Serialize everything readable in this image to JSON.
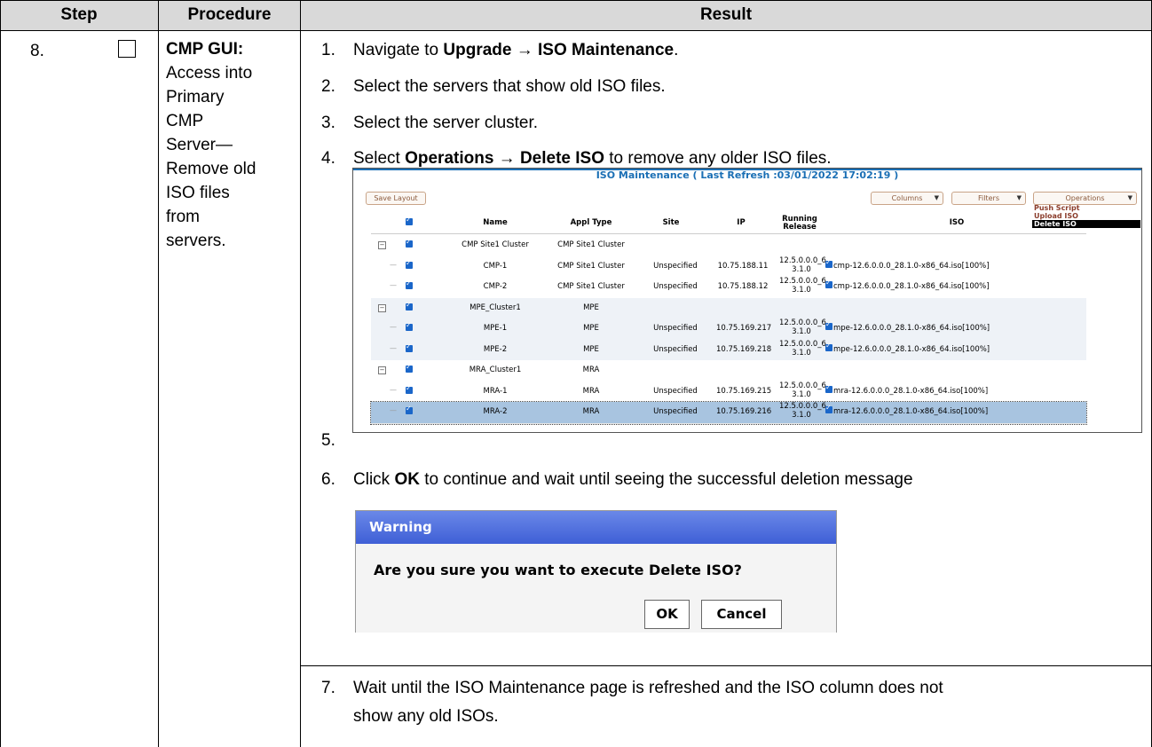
{
  "headers": {
    "step": "Step",
    "procedure": "Procedure",
    "result": "Result"
  },
  "step_number": "8.",
  "procedure": {
    "heading": "CMP GUI:",
    "lines": [
      "Access into",
      "Primary",
      "CMP",
      "Server—",
      "Remove old",
      "ISO files",
      "from",
      "servers."
    ]
  },
  "steps": {
    "s1": {
      "num": "1.",
      "pre": "Navigate to ",
      "bold": "Upgrade → ISO Maintenance",
      "post": "."
    },
    "s2": {
      "num": "2.",
      "text": "Select the servers that show old ISO files."
    },
    "s3": {
      "num": "3.",
      "text": "Select the server cluster."
    },
    "s4": {
      "num": "4.",
      "pre": "Select ",
      "bold": "Operations → Delete ISO",
      "post": " to remove any older ISO files."
    },
    "s5": {
      "num": "5."
    },
    "s6": {
      "num": "6.",
      "pre": "Click ",
      "bold": "OK",
      "post": " to continue and wait until seeing the successful deletion message"
    },
    "s7": {
      "num": "7.",
      "line1": "Wait until the ISO Maintenance page is refreshed and the ISO column does not",
      "line2": "show any old ISOs."
    }
  },
  "iso_screen": {
    "title": "ISO Maintenance ( Last Refresh :03/01/2022 17:02:19 )",
    "save_layout": "Save Layout",
    "columns_btn": "Columns",
    "filters_btn": "Filters",
    "operations_btn": "Operations",
    "operations_menu": [
      "Push Script",
      "Upload ISO",
      "Delete ISO"
    ],
    "columns": {
      "name": "Name",
      "appl_type": "Appl Type",
      "site": "Site",
      "ip": "IP",
      "running_release_1": "Running",
      "running_release_2": "Release",
      "iso": "ISO"
    },
    "rows": [
      {
        "kind": "cluster",
        "name": "CMP Site1 Cluster",
        "appl": "CMP Site1 Cluster",
        "site": "",
        "ip": "",
        "rel1": "",
        "rel2": "",
        "iso": ""
      },
      {
        "kind": "server",
        "name": "CMP-1",
        "appl": "CMP Site1 Cluster",
        "site": "Unspecified",
        "ip": "10.75.188.11",
        "rel1": "12.5.0.0.0_6",
        "rel2": "3.1.0",
        "iso": "cmp-12.6.0.0.0_28.1.0-x86_64.iso[100%]"
      },
      {
        "kind": "server",
        "name": "CMP-2",
        "appl": "CMP Site1 Cluster",
        "site": "Unspecified",
        "ip": "10.75.188.12",
        "rel1": "12.5.0.0.0_6",
        "rel2": "3.1.0",
        "iso": "cmp-12.6.0.0.0_28.1.0-x86_64.iso[100%]"
      },
      {
        "kind": "cluster",
        "name": "MPE_Cluster1",
        "appl": "MPE",
        "site": "",
        "ip": "",
        "rel1": "",
        "rel2": "",
        "iso": ""
      },
      {
        "kind": "server",
        "name": "MPE-1",
        "appl": "MPE",
        "site": "Unspecified",
        "ip": "10.75.169.217",
        "rel1": "12.5.0.0.0_6",
        "rel2": "3.1.0",
        "iso": "mpe-12.6.0.0.0_28.1.0-x86_64.iso[100%]"
      },
      {
        "kind": "server",
        "name": "MPE-2",
        "appl": "MPE",
        "site": "Unspecified",
        "ip": "10.75.169.218",
        "rel1": "12.5.0.0.0_6",
        "rel2": "3.1.0",
        "iso": "mpe-12.6.0.0.0_28.1.0-x86_64.iso[100%]"
      },
      {
        "kind": "cluster",
        "name": "MRA_Cluster1",
        "appl": "MRA",
        "site": "",
        "ip": "",
        "rel1": "",
        "rel2": "",
        "iso": ""
      },
      {
        "kind": "server",
        "name": "MRA-1",
        "appl": "MRA",
        "site": "Unspecified",
        "ip": "10.75.169.215",
        "rel1": "12.5.0.0.0_6",
        "rel2": "3.1.0",
        "iso": "mra-12.6.0.0.0_28.1.0-x86_64.iso[100%]"
      },
      {
        "kind": "server",
        "name": "MRA-2",
        "appl": "MRA",
        "site": "Unspecified",
        "ip": "10.75.169.216",
        "rel1": "12.5.0.0.0_6",
        "rel2": "3.1.0",
        "iso": "mra-12.6.0.0.0_28.1.0-x86_64.iso[100%]"
      }
    ]
  },
  "warning_dialog": {
    "title": "Warning",
    "message": "Are you sure you want to execute Delete ISO?",
    "ok": "OK",
    "cancel": "Cancel"
  },
  "colors": {
    "header_bg": "#d9d9d9",
    "iso_title": "#1a6fb5",
    "dialog_title": "#3f5fd6",
    "selected_row": "#a8c4e0"
  }
}
